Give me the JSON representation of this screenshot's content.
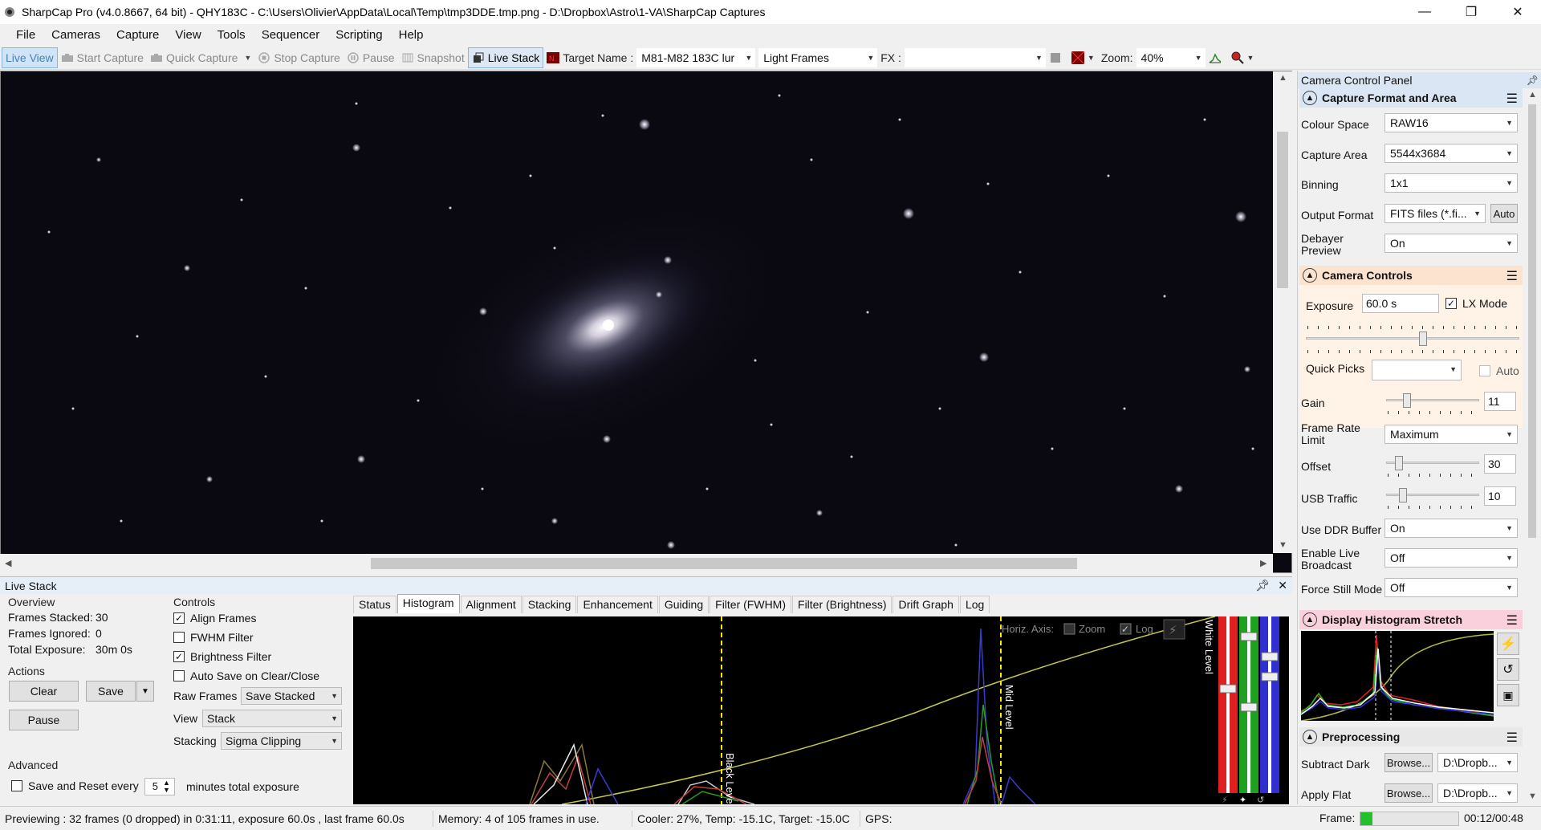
{
  "window": {
    "title": "SharpCap Pro (v4.0.8667, 64 bit) - QHY183C - C:\\Users\\Olivier\\AppData\\Local\\Temp\\tmp3DDE.tmp.png - D:\\Dropbox\\Astro\\1-VA\\SharpCap Captures",
    "minimize": "—",
    "restore": "❐",
    "close": "✕"
  },
  "menu": [
    "File",
    "Cameras",
    "Capture",
    "View",
    "Tools",
    "Sequencer",
    "Scripting",
    "Help"
  ],
  "toolbar": {
    "live_view": "Live View",
    "start_capture": "Start Capture",
    "quick_capture": "Quick Capture",
    "stop_capture": "Stop Capture",
    "pause": "Pause",
    "snapshot": "Snapshot",
    "live_stack": "Live Stack",
    "target_name_label": "Target Name :",
    "target_name_value": "M81-M82 183C lur",
    "frame_type": "Light Frames",
    "fx_label": "FX :",
    "fx_value": "",
    "zoom_label": "Zoom:",
    "zoom_value": "40%"
  },
  "live_stack": {
    "title": "Live Stack",
    "overview_label": "Overview",
    "frames_stacked_label": "Frames Stacked:",
    "frames_stacked": "30",
    "frames_ignored_label": "Frames Ignored:",
    "frames_ignored": "0",
    "total_exposure_label": "Total Exposure:",
    "total_exposure": "30m 0s",
    "actions_label": "Actions",
    "clear": "Clear",
    "save": "Save",
    "pause": "Pause",
    "controls_label": "Controls",
    "align_frames": "Align Frames",
    "fwhm_filter": "FWHM Filter",
    "brightness_filter": "Brightness Filter",
    "auto_save": "Auto Save on Clear/Close",
    "raw_frames_label": "Raw Frames",
    "raw_frames_value": "Save Stacked",
    "view_label": "View",
    "view_value": "Stack",
    "stacking_label": "Stacking",
    "stacking_value": "Sigma Clipping",
    "advanced_label": "Advanced",
    "save_reset_label": "Save and Reset every",
    "save_reset_value": "5",
    "save_reset_suffix": "minutes total exposure",
    "tabs": [
      "Status",
      "Histogram",
      "Alignment",
      "Stacking",
      "Enhancement",
      "Guiding",
      "Filter (FWHM)",
      "Filter (Brightness)",
      "Drift Graph",
      "Log"
    ],
    "histogram": {
      "horiz_axis": "Horiz. Axis:",
      "zoom": "Zoom",
      "log": "Log",
      "black_level": "Black Level",
      "mid_level": "Mid Level",
      "white_level": "White Level"
    }
  },
  "status": {
    "previewing": "Previewing : 32 frames (0 dropped) in 0:31:11, exposure 60.0s , last frame 60.0s",
    "memory": "Memory: 4 of 105 frames in use.",
    "cooler": "Cooler: 27%, Temp: -15.1C, Target: -15.0C",
    "gps": "GPS:",
    "frame_label": "Frame:",
    "time": "00:12/00:48"
  },
  "control_panel": {
    "title": "Camera Control Panel",
    "capture_format": {
      "header": "Capture Format and Area",
      "colour_space_label": "Colour Space",
      "colour_space": "RAW16",
      "capture_area_label": "Capture Area",
      "capture_area": "5544x3684",
      "binning_label": "Binning",
      "binning": "1x1",
      "output_format_label": "Output Format",
      "output_format": "FITS files (*.fi...",
      "auto": "Auto",
      "debayer_label": "Debayer Preview",
      "debayer": "On"
    },
    "camera_controls": {
      "header": "Camera Controls",
      "exposure_label": "Exposure",
      "exposure": "60.0 s",
      "lx_mode": "LX Mode",
      "quick_picks_label": "Quick Picks",
      "quick_picks": "",
      "auto": "Auto",
      "gain_label": "Gain",
      "gain": "11",
      "frame_rate_label": "Frame Rate Limit",
      "frame_rate": "Maximum",
      "offset_label": "Offset",
      "offset": "30",
      "usb_label": "USB Traffic",
      "usb": "10",
      "ddr_label": "Use DDR Buffer",
      "ddr": "On",
      "broadcast_label": "Enable Live Broadcast",
      "broadcast": "Off",
      "still_label": "Force Still Mode",
      "still": "Off"
    },
    "display_stretch": {
      "header": "Display Histogram Stretch"
    },
    "preprocessing": {
      "header": "Preprocessing",
      "subtract_dark_label": "Subtract Dark",
      "browse": "Browse...",
      "dark_path": "D:\\Dropb...",
      "apply_flat_label": "Apply Flat",
      "flat_path": "D:\\Dropb..."
    }
  },
  "colors": {
    "sky": "#0a0810",
    "accent": "#dbe6f4",
    "camera_controls": "#fbe3cf",
    "histogram_stretch": "#f9d0dc",
    "frame_progress": "#22c02a"
  },
  "levels": {
    "gain_slider": 0.2,
    "offset_slider": 0.1,
    "usb_slider": 0.15,
    "exposure_slider": 0.55,
    "frame_progress": 0.12
  }
}
